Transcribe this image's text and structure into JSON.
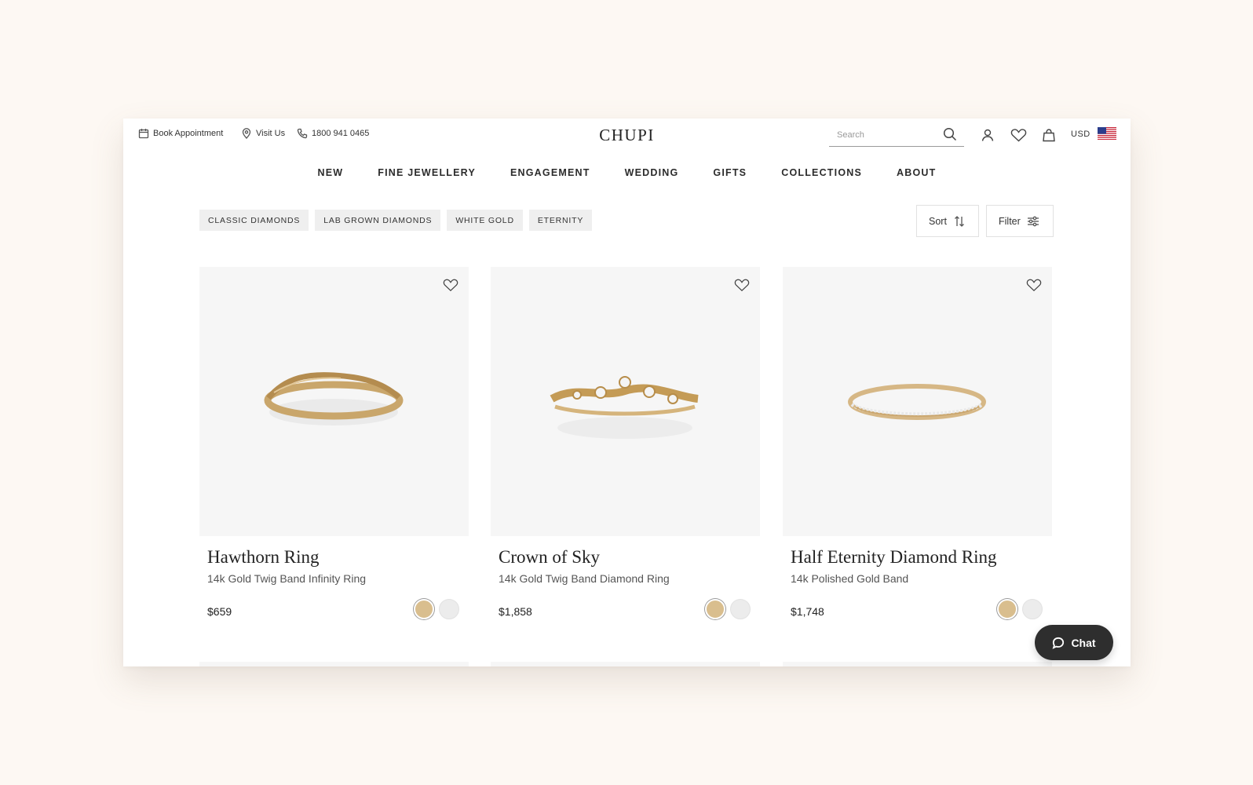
{
  "topbar": {
    "book_appointment": "Book Appointment",
    "visit_us": "Visit Us",
    "phone": "1800 941 0465",
    "logo": "CHUPI",
    "search_placeholder": "Search",
    "currency": "USD"
  },
  "nav": {
    "items": [
      {
        "label": "NEW"
      },
      {
        "label": "FINE JEWELLERY"
      },
      {
        "label": "ENGAGEMENT"
      },
      {
        "label": "WEDDING"
      },
      {
        "label": "GIFTS"
      },
      {
        "label": "COLLECTIONS"
      },
      {
        "label": "ABOUT"
      }
    ]
  },
  "filters": {
    "chips": [
      {
        "label": "CLASSIC DIAMONDS"
      },
      {
        "label": "LAB GROWN DIAMONDS"
      },
      {
        "label": "WHITE GOLD"
      },
      {
        "label": "ETERNITY"
      }
    ],
    "sort_label": "Sort",
    "filter_label": "Filter"
  },
  "products": [
    {
      "title": "Hawthorn Ring",
      "subtitle": "14k Gold Twig Band Infinity Ring",
      "price": "$659",
      "selected_metal": "gold",
      "metals": [
        "gold",
        "white"
      ]
    },
    {
      "title": "Crown of Sky",
      "subtitle": "14k Gold Twig Band Diamond Ring",
      "price": "$1,858",
      "selected_metal": "gold",
      "metals": [
        "gold",
        "white"
      ]
    },
    {
      "title": "Half Eternity Diamond Ring",
      "subtitle": "14k Polished Gold Band",
      "price": "$1,748",
      "selected_metal": "gold",
      "metals": [
        "gold",
        "white"
      ]
    }
  ],
  "chat": {
    "label": "Chat"
  },
  "colors": {
    "page_background": "#fdf8f3",
    "card_background": "#f6f6f6",
    "chip_background": "#efefef",
    "gold_swatch": "#d9be8e",
    "white_swatch": "#ececec",
    "chat_button": "#2e2e2e"
  },
  "icons": [
    "calendar-icon",
    "location-pin-icon",
    "phone-icon",
    "search-icon",
    "user-icon",
    "heart-icon",
    "bag-icon",
    "us-flag-icon",
    "sort-arrows-icon",
    "filter-sliders-icon",
    "chat-bubble-icon"
  ]
}
